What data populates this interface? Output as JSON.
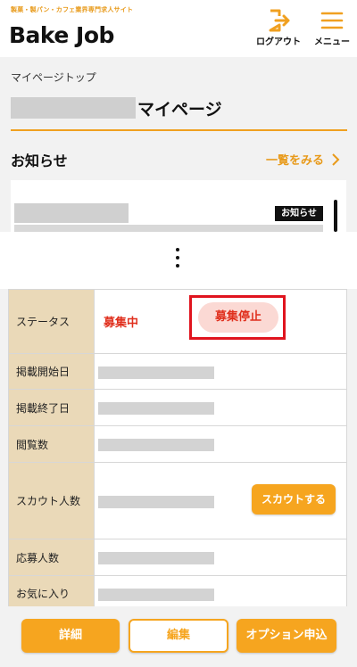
{
  "header": {
    "tagline": "製菓・製パン・カフェ業界専門求人サイト",
    "logo_text": "Bake Job",
    "logout_label": "ログアウト",
    "menu_label": "メニュー",
    "accent_color": "#f0a020"
  },
  "breadcrumb": "マイページトップ",
  "page_title_suffix": "マイページ",
  "news": {
    "heading": "お知らせ",
    "more_label": "一覧をみる",
    "badge": "お知らせ"
  },
  "details": {
    "rows": [
      {
        "label": "ステータス"
      },
      {
        "label": "掲載開始日"
      },
      {
        "label": "掲載終了日"
      },
      {
        "label": "閲覧数"
      },
      {
        "label": "スカウト人数"
      },
      {
        "label": "応募人数"
      },
      {
        "label": "お気に入り"
      }
    ],
    "status_value": "募集中",
    "stop_button": "募集停止",
    "scout_button": "スカウトする"
  },
  "bottom_bar": {
    "detail": "詳細",
    "edit": "編集",
    "option": "オプション申込"
  }
}
